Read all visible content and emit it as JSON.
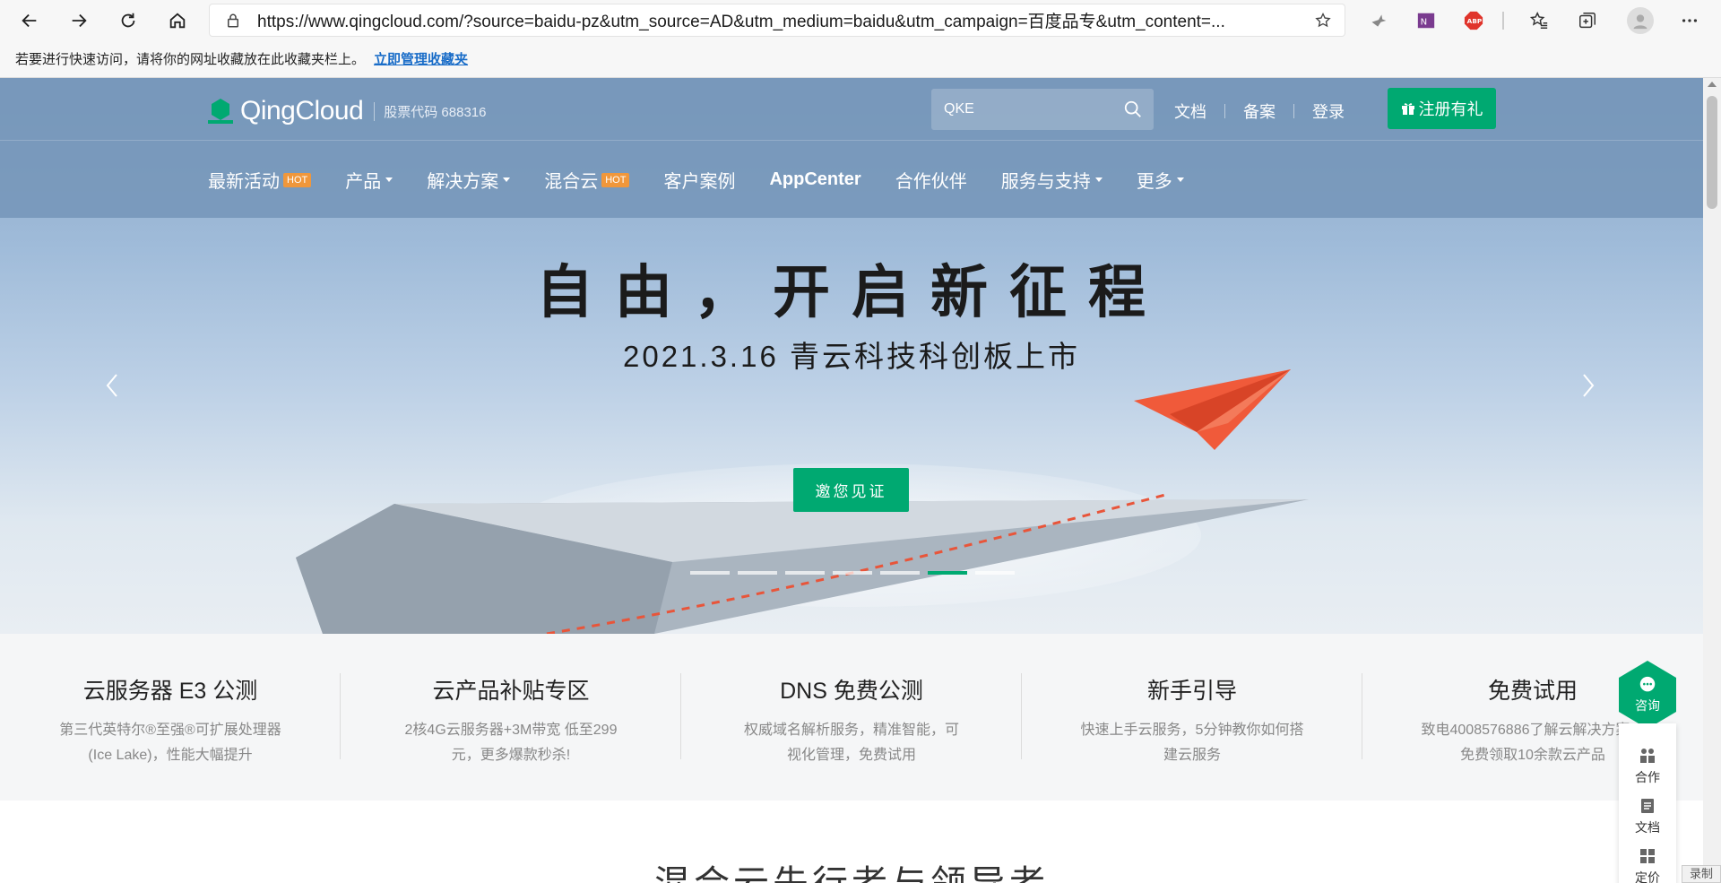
{
  "browser": {
    "url": "https://www.qingcloud.com/?source=baidu-pz&utm_source=AD&utm_medium=baidu&utm_campaign=百度品专&utm_content=...",
    "favorites_hint": "若要进行快速访问，请将你的网址收藏放在此收藏夹栏上。",
    "favorites_link": "立即管理收藏夹",
    "extensions": [
      "bird-icon",
      "onenote-icon",
      "abp-icon"
    ]
  },
  "header": {
    "logo_text": "QingCloud",
    "stock": "股票代码 688316",
    "search_value": "QKE",
    "links": [
      "文档",
      "备案",
      "登录"
    ],
    "register": "注册有礼"
  },
  "menu": [
    {
      "label": "最新活动",
      "hot": "HOT"
    },
    {
      "label": "产品",
      "caret": true
    },
    {
      "label": "解决方案",
      "caret": true
    },
    {
      "label": "混合云",
      "hot": "HOT"
    },
    {
      "label": "客户案例"
    },
    {
      "label": "AppCenter",
      "bold": true
    },
    {
      "label": "合作伙伴"
    },
    {
      "label": "服务与支持",
      "caret": true
    },
    {
      "label": "更多",
      "caret": true
    }
  ],
  "hero": {
    "title": "自由，开启新征程",
    "subtitle": "2021.3.16 青云科技科创板上市",
    "cta": "邀您见证",
    "slides_count": 7,
    "active_slide": 6
  },
  "features": [
    {
      "title": "云服务器 E3 公测",
      "desc": "第三代英特尔®至强®可扩展处理器(Ice Lake)，性能大幅提升"
    },
    {
      "title": "云产品补贴专区",
      "desc": "2核4G云服务器+3M带宽 低至299元，更多爆款秒杀!"
    },
    {
      "title": "DNS 免费公测",
      "desc": "权威域名解析服务，精准智能，可视化管理，免费试用"
    },
    {
      "title": "新手引导",
      "desc": "快速上手云服务，5分钟教你如何搭建云服务"
    },
    {
      "title": "免费试用",
      "desc": "致电4008576886了解云解决方案，免费领取10余款云产品"
    }
  ],
  "section_title": "混合云先行者与领导者",
  "float_widget": {
    "consult": "咨询",
    "items": [
      "合作",
      "文档",
      "定价"
    ]
  },
  "record_label": "录制",
  "colors": {
    "brand_green": "#00a971",
    "hot_orange": "#f0973b",
    "plane_red": "#f05a3a"
  }
}
